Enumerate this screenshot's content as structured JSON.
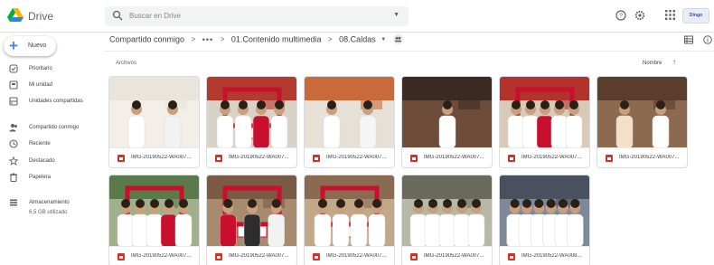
{
  "app": {
    "title": "Drive"
  },
  "search": {
    "placeholder": "Buscar en Drive"
  },
  "header": {
    "brand_badge": "Dingo"
  },
  "sidebar": {
    "new_label": "Nuevo",
    "items": [
      {
        "label": "Prioritario",
        "icon": "check-circle-icon"
      },
      {
        "label": "Mi unidad",
        "icon": "drive-folder-icon"
      },
      {
        "label": "Unidades compartidas",
        "icon": "shared-drives-icon"
      },
      {
        "label": "Compartido conmigo",
        "icon": "people-icon"
      },
      {
        "label": "Reciente",
        "icon": "clock-icon"
      },
      {
        "label": "Destacado",
        "icon": "star-icon"
      },
      {
        "label": "Papelera",
        "icon": "trash-icon"
      },
      {
        "label": "Almacenamiento",
        "icon": "storage-icon"
      }
    ],
    "storage_used": "6,5 GB utilizado"
  },
  "breadcrumb": {
    "root": "Compartido conmigo",
    "more": "•••",
    "parent": "01.Contenido multimedia",
    "current": "08.Caldas"
  },
  "list": {
    "section_title": "Archivos",
    "sort_label": "Nombre",
    "sort_direction": "ascending"
  },
  "files": [
    {
      "name": "IMG-20190522-WA007..."
    },
    {
      "name": "IMG-20190522-WA007..."
    },
    {
      "name": "IMG-20190522-WA007..."
    },
    {
      "name": "IMG-20190522-WA007..."
    },
    {
      "name": "IMG-20190522-WA007..."
    },
    {
      "name": "IMG-20190522-WA007..."
    },
    {
      "name": "IMG-20190522-WA007..."
    },
    {
      "name": "IMG-20190522-WA007..."
    },
    {
      "name": "IMG-20190522-WA007..."
    },
    {
      "name": "IMG-20190522-WA007..."
    },
    {
      "name": "IMG-20190522-WA008..."
    }
  ],
  "colors": {
    "accent_blue": "#4285f4",
    "file_icon_red": "#d93025",
    "campaign_red": "#c8102e"
  }
}
